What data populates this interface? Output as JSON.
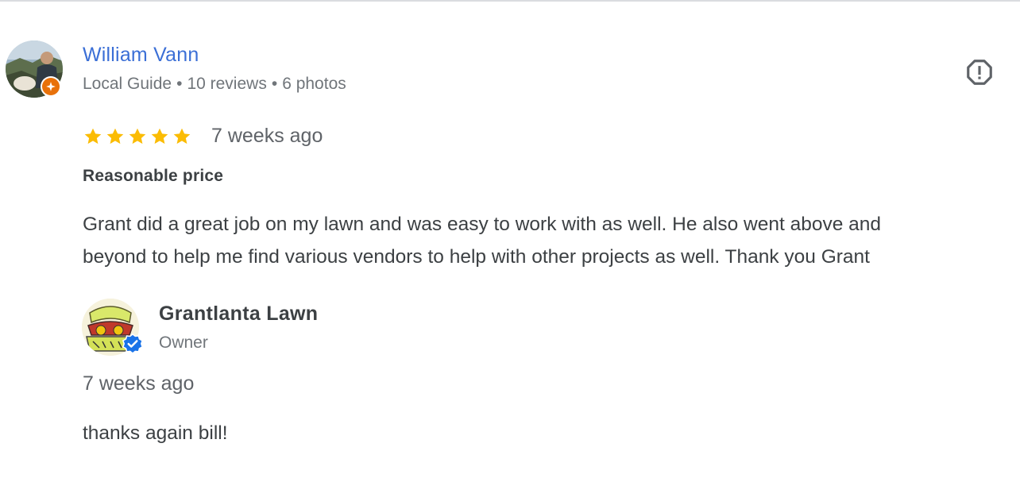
{
  "reviewer": {
    "name": "William Vann",
    "badge": "Local Guide",
    "reviews": "10 reviews",
    "photos": "6 photos",
    "separator": "•"
  },
  "review": {
    "rating": 5,
    "max_rating": 5,
    "time": "7 weeks ago",
    "tag": "Reasonable price",
    "text_lines": [
      "Grant did a great job on my lawn and was easy to work with as well. He also went above and",
      "beyond to help me find various vendors to help with other projects as well. Thank you Grant"
    ]
  },
  "owner_reply": {
    "name": "Grantlanta Lawn",
    "role": "Owner",
    "time": "7 weeks ago",
    "text": "thanks again bill!"
  },
  "icons": {
    "report": "report-icon",
    "star": "star-icon",
    "local_guide": "local-guide-badge-icon",
    "verified": "verified-badge-icon"
  },
  "colors": {
    "link_blue": "#3b6fd6",
    "star_gold": "#fbbc04",
    "local_guide_orange": "#e8710a",
    "verified_blue": "#1a73e8",
    "muted_text": "#70757a",
    "body_text": "#3c4043"
  }
}
